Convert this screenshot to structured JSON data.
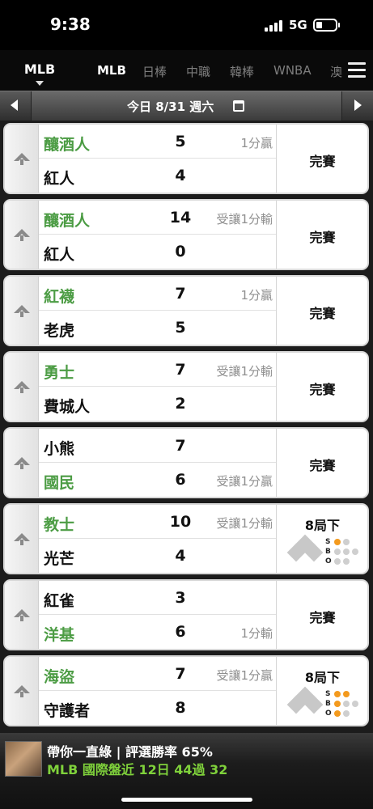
{
  "status_bar": {
    "time": "9:38",
    "network": "5G"
  },
  "league_selector": {
    "label": "MLB"
  },
  "tabs": [
    {
      "label": "MLB",
      "active": true
    },
    {
      "label": "日棒",
      "active": false
    },
    {
      "label": "中職",
      "active": false
    },
    {
      "label": "韓棒",
      "active": false
    },
    {
      "label": "WNBA",
      "active": false
    },
    {
      "label": "澳",
      "active": false
    }
  ],
  "date_bar": {
    "label": "今日 8/31 週六"
  },
  "games": [
    {
      "home": {
        "name": "釀酒人",
        "score": "5",
        "note": "1分贏",
        "winner": true
      },
      "away": {
        "name": "紅人",
        "score": "4",
        "note": "",
        "winner": false
      },
      "status": "完賽"
    },
    {
      "home": {
        "name": "釀酒人",
        "score": "14",
        "note": "受讓1分輸",
        "winner": true
      },
      "away": {
        "name": "紅人",
        "score": "0",
        "note": "",
        "winner": false
      },
      "status": "完賽"
    },
    {
      "home": {
        "name": "紅襪",
        "score": "7",
        "note": "1分贏",
        "winner": true
      },
      "away": {
        "name": "老虎",
        "score": "5",
        "note": "",
        "winner": false
      },
      "status": "完賽"
    },
    {
      "home": {
        "name": "勇士",
        "score": "7",
        "note": "受讓1分輸",
        "winner": true
      },
      "away": {
        "name": "費城人",
        "score": "2",
        "note": "",
        "winner": false
      },
      "status": "完賽"
    },
    {
      "home": {
        "name": "小熊",
        "score": "7",
        "note": "",
        "winner": false
      },
      "away": {
        "name": "國民",
        "score": "6",
        "note": "受讓1分贏",
        "winner": true
      },
      "status": "完賽"
    },
    {
      "home": {
        "name": "教士",
        "score": "10",
        "note": "受讓1分輸",
        "winner": true
      },
      "away": {
        "name": "光芒",
        "score": "4",
        "note": "",
        "winner": false
      },
      "status": "8局下",
      "live": true,
      "strikes": 1,
      "balls": 0,
      "outs": 0
    },
    {
      "home": {
        "name": "紅雀",
        "score": "3",
        "note": "",
        "winner": false
      },
      "away": {
        "name": "洋基",
        "score": "6",
        "note": "1分輸",
        "winner": true
      },
      "status": "完賽"
    },
    {
      "home": {
        "name": "海盜",
        "score": "7",
        "note": "受讓1分贏",
        "winner": true
      },
      "away": {
        "name": "守護者",
        "score": "8",
        "note": "",
        "winner": false
      },
      "status": "8局下",
      "live": true,
      "strikes": 2,
      "balls": 1,
      "outs": 1
    }
  ],
  "sbo_labels": [
    "S",
    "B",
    "O"
  ],
  "banner": {
    "line1": "帶你一直綠 | 評選勝率 65%",
    "line2": "MLB 國際盤近 12日 44過 32"
  },
  "colors": {
    "win_green": "#4c9c44",
    "live_dot": "#f39a1e",
    "banner_green": "#7fd13b"
  }
}
